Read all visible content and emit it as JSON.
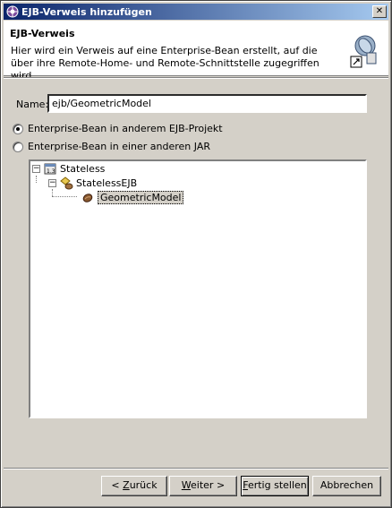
{
  "window": {
    "title": "EJB-Verweis hinzufügen",
    "close_glyph": "✕"
  },
  "banner": {
    "title": "EJB-Verweis",
    "description": "Hier wird ein Verweis auf eine Enterprise-Bean erstellt, auf die über ihre Remote-Home- und Remote-Schnittstelle zugegriffen wird.",
    "icon": "ejb-wizard-icon"
  },
  "form": {
    "name_label": "Name:",
    "name_value": "ejb/GeometricModel"
  },
  "options": [
    {
      "label": "Enterprise-Bean in anderem EJB-Projekt",
      "checked": true
    },
    {
      "label": "Enterprise-Bean in einer anderen JAR",
      "checked": false
    }
  ],
  "tree": {
    "root": {
      "label": "Stateless",
      "icon": "ejb-project-icon",
      "expander": "−"
    },
    "child": {
      "label": "StatelessEJB",
      "icon": "ejb-module-icon",
      "expander": "−"
    },
    "leaf": {
      "label": "GeometricModel",
      "icon": "bean-icon",
      "selected": true
    }
  },
  "buttons": {
    "back": {
      "prefix": "< ",
      "mnemonic": "Z",
      "rest": "urück"
    },
    "next": {
      "mnemonic": "W",
      "rest": "eiter",
      "suffix": " >"
    },
    "finish": {
      "mnemonic": "F",
      "rest": "ertig stellen"
    },
    "cancel": {
      "label": "Abbrechen"
    }
  },
  "colors": {
    "titlebar_start": "#0a246a",
    "titlebar_end": "#a6caf0",
    "face": "#d4d0c8"
  }
}
